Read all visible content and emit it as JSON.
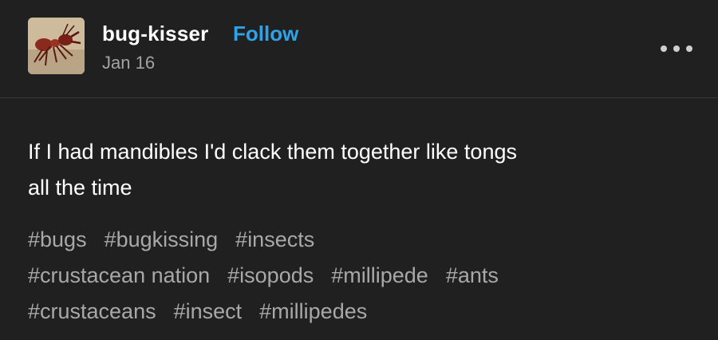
{
  "post": {
    "username": "bug-kisser",
    "follow_label": "Follow",
    "date": "Jan 16",
    "more_icon": "more-horizontal-icon",
    "body_line1": "If I had mandibles I'd clack them together like tongs",
    "body_line2": "all the time",
    "tags": [
      "#bugs",
      "#bugkissing",
      "#insects",
      "#crustacean nation",
      "#isopods",
      "#millipede",
      "#ants",
      "#crustaceans",
      "#insect",
      "#millipedes"
    ]
  },
  "colors": {
    "background": "#202021",
    "follow_accent": "#30a2e8",
    "muted_text": "#a8a8a8"
  }
}
